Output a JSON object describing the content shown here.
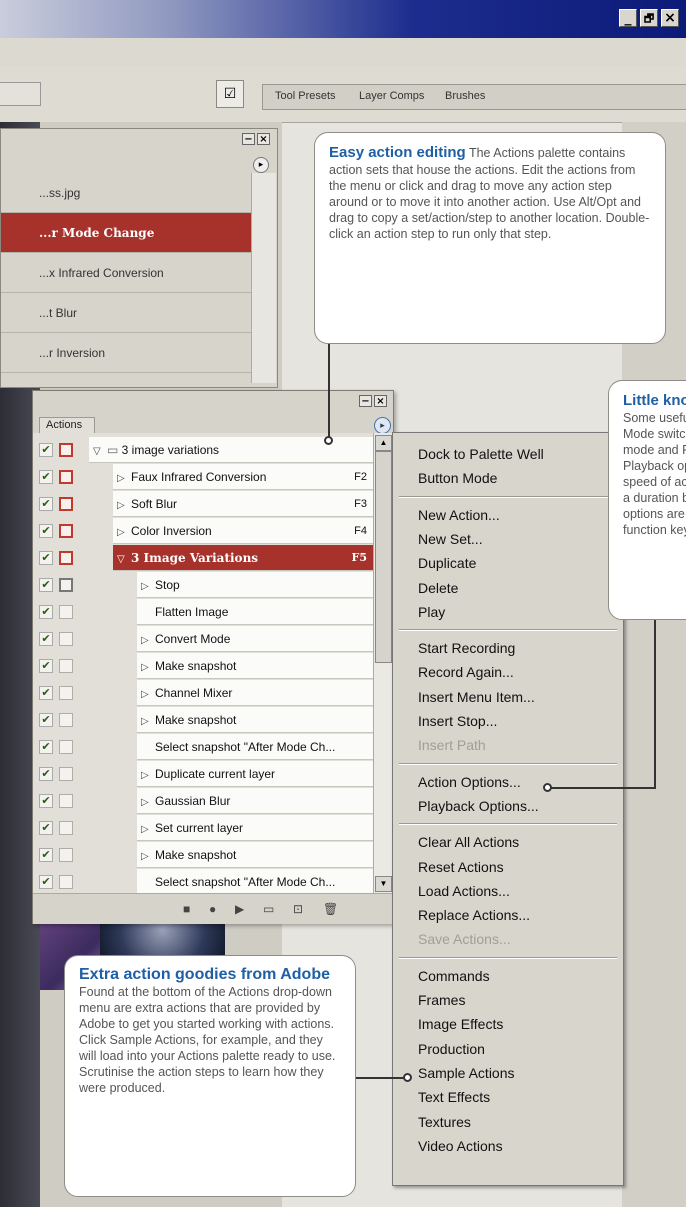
{
  "window": {
    "buttons": [
      "_",
      "🗗",
      "×"
    ]
  },
  "options_bar": {
    "tabs": [
      "Tool Presets",
      "Layer Comps",
      "Brushes"
    ]
  },
  "history": {
    "items": [
      {
        "label": "...ss.jpg",
        "selected": false
      },
      {
        "label": "...r Mode Change",
        "selected": true
      },
      {
        "label": "...x Infrared Conversion",
        "selected": false
      },
      {
        "label": "...t Blur",
        "selected": false
      },
      {
        "label": "...r Inversion",
        "selected": false
      }
    ]
  },
  "actions": {
    "tab_label": "Actions",
    "rows": [
      {
        "label": "3 image variations",
        "indent": 0,
        "kind": "set",
        "expanded": true,
        "fkey": "",
        "dialog": "red"
      },
      {
        "label": "Faux Infrared Conversion",
        "indent": 1,
        "kind": "action",
        "expanded": false,
        "fkey": "F2",
        "dialog": "red"
      },
      {
        "label": "Soft Blur",
        "indent": 1,
        "kind": "action",
        "expanded": false,
        "fkey": "F3",
        "dialog": "red"
      },
      {
        "label": "Color Inversion",
        "indent": 1,
        "kind": "action",
        "expanded": false,
        "fkey": "F4",
        "dialog": "red"
      },
      {
        "label": "3 Image Variations",
        "indent": 1,
        "kind": "action",
        "expanded": true,
        "fkey": "F5",
        "dialog": "red",
        "selected": true
      },
      {
        "label": "Stop",
        "indent": 2,
        "kind": "step",
        "expandable": true,
        "dialog": "gry"
      },
      {
        "label": "Flatten Image",
        "indent": 2,
        "kind": "step",
        "expandable": false,
        "dialog": "none"
      },
      {
        "label": "Convert Mode",
        "indent": 2,
        "kind": "step",
        "expandable": true,
        "dialog": "none"
      },
      {
        "label": "Make snapshot",
        "indent": 2,
        "kind": "step",
        "expandable": true,
        "dialog": "box"
      },
      {
        "label": "Channel Mixer",
        "indent": 2,
        "kind": "step",
        "expandable": true,
        "dialog": "box"
      },
      {
        "label": "Make snapshot",
        "indent": 2,
        "kind": "step",
        "expandable": true,
        "dialog": "box"
      },
      {
        "label": "Select snapshot \"After Mode Ch...",
        "indent": 2,
        "kind": "step",
        "expandable": false,
        "dialog": "none"
      },
      {
        "label": "Duplicate current layer",
        "indent": 2,
        "kind": "step",
        "expandable": true,
        "dialog": "box"
      },
      {
        "label": "Gaussian Blur",
        "indent": 2,
        "kind": "step",
        "expandable": true,
        "dialog": "box"
      },
      {
        "label": "Set current layer",
        "indent": 2,
        "kind": "step",
        "expandable": true,
        "dialog": "box"
      },
      {
        "label": "Make snapshot",
        "indent": 2,
        "kind": "step",
        "expandable": true,
        "dialog": "box"
      },
      {
        "label": "Select snapshot \"After Mode Ch...",
        "indent": 2,
        "kind": "step",
        "expandable": false,
        "dialog": "none"
      }
    ],
    "bottom_icons": [
      "stop-icon",
      "record-icon",
      "play-icon",
      "new-set-icon",
      "new-action-icon",
      "trash-icon"
    ]
  },
  "menu": {
    "groups": [
      [
        {
          "label": "Dock to Palette Well"
        },
        {
          "label": "Button Mode"
        }
      ],
      [
        {
          "label": "New Action..."
        },
        {
          "label": "New Set..."
        },
        {
          "label": "Duplicate"
        },
        {
          "label": "Delete"
        },
        {
          "label": "Play"
        }
      ],
      [
        {
          "label": "Start Recording"
        },
        {
          "label": "Record Again..."
        },
        {
          "label": "Insert Menu Item..."
        },
        {
          "label": "Insert Stop..."
        },
        {
          "label": "Insert Path",
          "disabled": true
        }
      ],
      [
        {
          "label": "Action Options..."
        },
        {
          "label": "Playback Options..."
        }
      ],
      [
        {
          "label": "Clear All Actions"
        },
        {
          "label": "Reset Actions"
        },
        {
          "label": "Load Actions..."
        },
        {
          "label": "Replace Actions..."
        },
        {
          "label": "Save Actions...",
          "disabled": true
        }
      ],
      [
        {
          "label": "Commands"
        },
        {
          "label": "Frames"
        },
        {
          "label": "Image Effects"
        },
        {
          "label": "Production"
        },
        {
          "label": "Sample Actions"
        },
        {
          "label": "Text Effects"
        },
        {
          "label": "Textures"
        },
        {
          "label": "Video Actions"
        }
      ]
    ]
  },
  "callouts": {
    "easy": {
      "title": "Easy action editing",
      "body": "The Actions palette contains action sets that house the actions. Edit the actions from the menu or click and drag to move any action step around or to move it into another action. Use Alt/Opt and drag to copy a set/action/step to another location. Double-click an action step to run only that step."
    },
    "little": {
      "title": "Little know",
      "lines": [
        "Some usefu",
        "Mode switc",
        "mode and P",
        "Playback op",
        "speed of act",
        "a duration b",
        "options are",
        "function key"
      ]
    },
    "extra": {
      "title": "Extra action goodies from Adobe",
      "body": "Found at the bottom of the Actions drop-down menu are extra actions that are provided by Adobe to get you started working with actions. Click Sample Actions, for example, and they will load into your Actions palette ready to use. Scrutinise the action steps to learn how they were produced."
    }
  },
  "colors": {
    "accent": "#1f5fa6",
    "selection": "#a7322b",
    "titlebar": "#0c1a78"
  }
}
